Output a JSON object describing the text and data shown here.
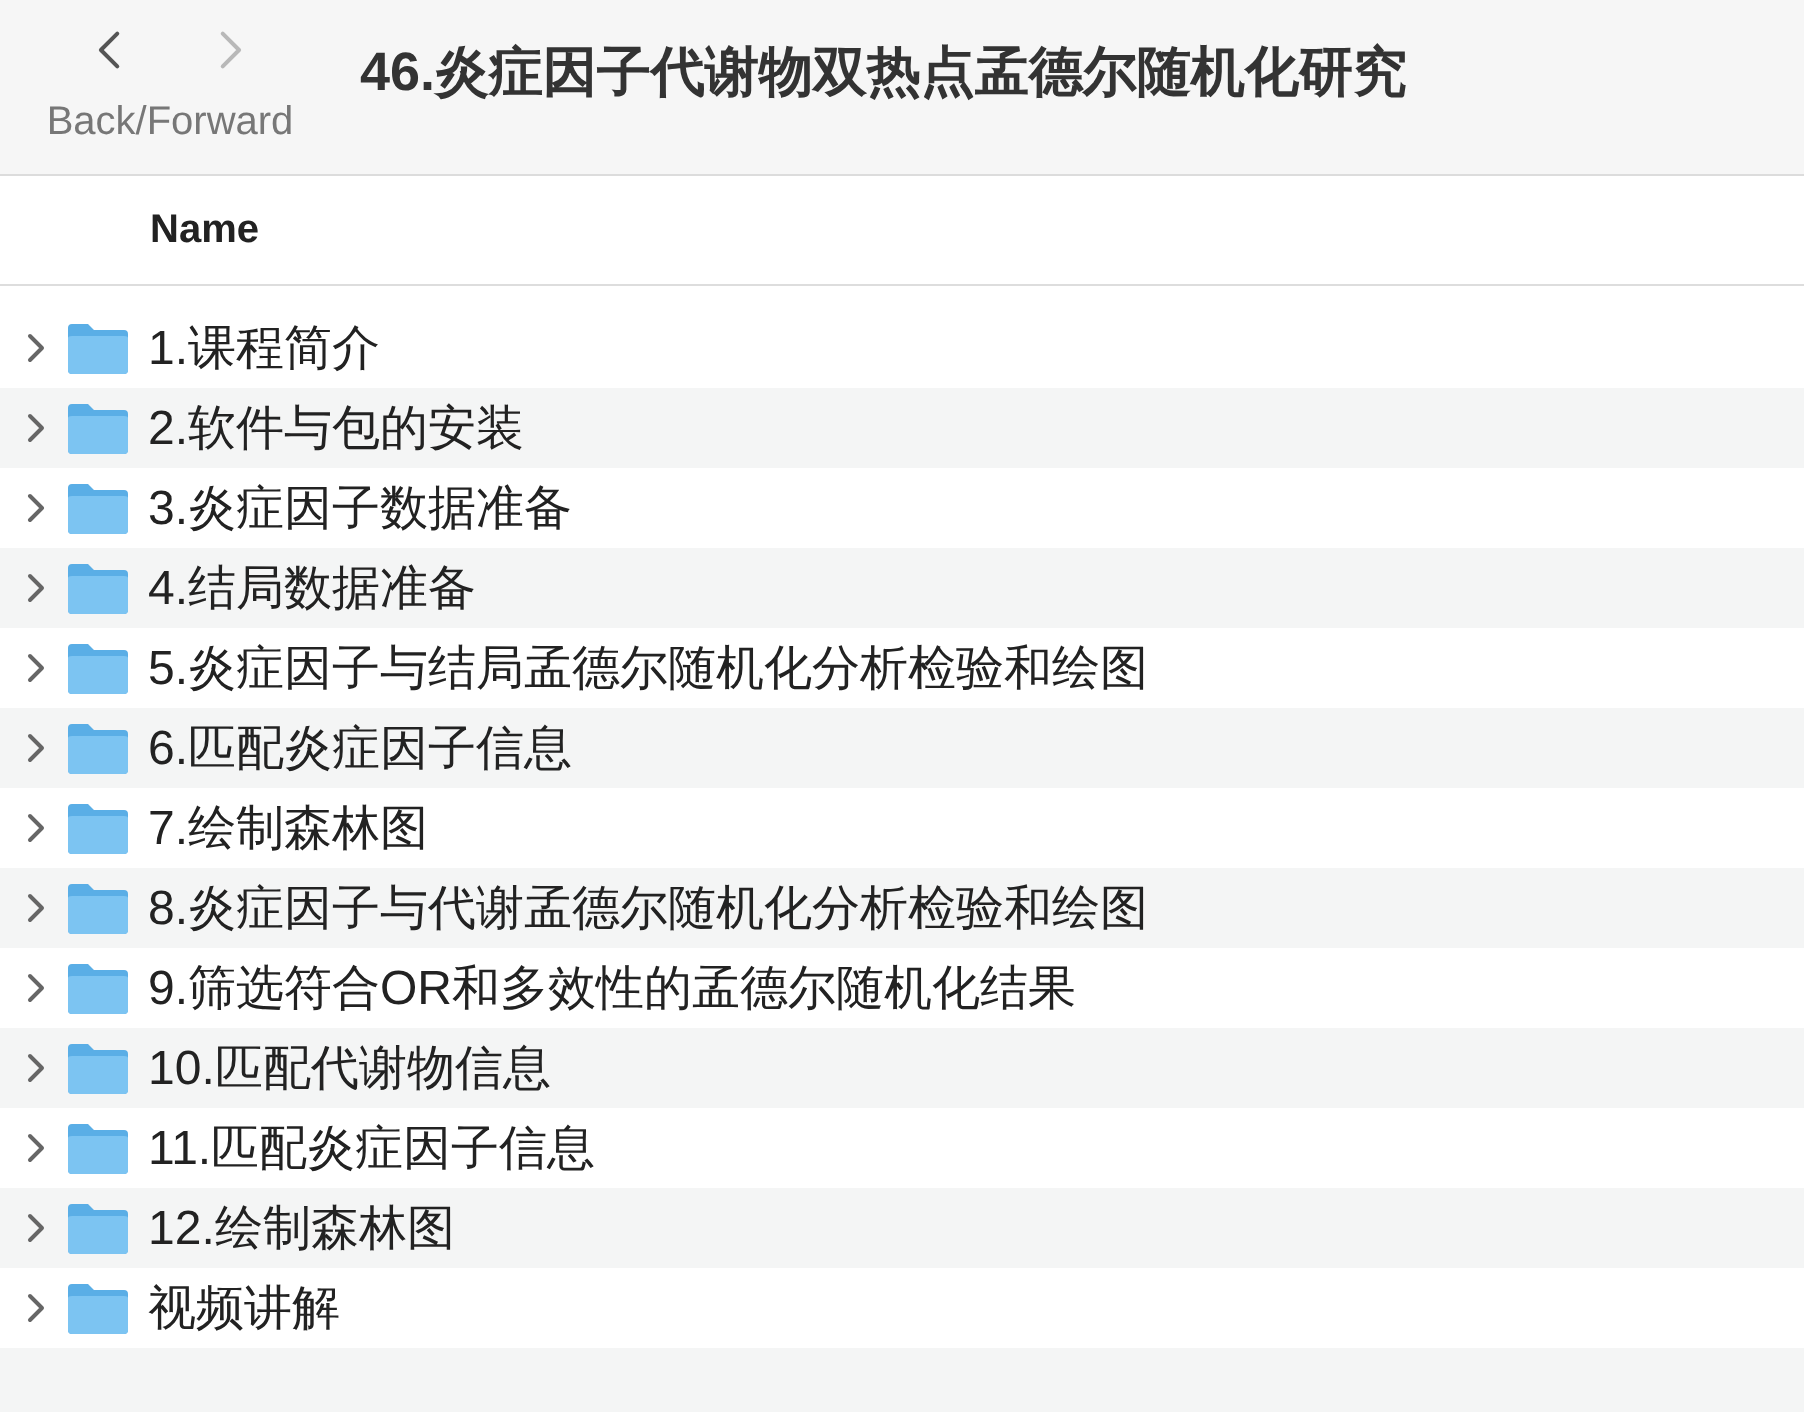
{
  "toolbar": {
    "nav_buttons": [
      {
        "kind": "back",
        "disabled": false
      },
      {
        "kind": "forward",
        "disabled": true
      }
    ],
    "nav_label": "Back/Forward",
    "title": "46.炎症因子代谢物双热点孟德尔随机化研究"
  },
  "table": {
    "columns": [
      "Name"
    ],
    "rows": [
      {
        "name": "1.课程简介",
        "expanded": false
      },
      {
        "name": "2.软件与包的安装",
        "expanded": false
      },
      {
        "name": "3.炎症因子数据准备",
        "expanded": false
      },
      {
        "name": "4.结局数据准备",
        "expanded": false
      },
      {
        "name": "5.炎症因子与结局孟德尔随机化分析检验和绘图",
        "expanded": false
      },
      {
        "name": "6.匹配炎症因子信息",
        "expanded": false
      },
      {
        "name": "7.绘制森林图",
        "expanded": false
      },
      {
        "name": "8.炎症因子与代谢孟德尔随机化分析检验和绘图",
        "expanded": false
      },
      {
        "name": "9.筛选符合OR和多效性的孟德尔随机化结果",
        "expanded": false
      },
      {
        "name": "10.匹配代谢物信息",
        "expanded": false
      },
      {
        "name": "11.匹配炎症因子信息",
        "expanded": false
      },
      {
        "name": "12.绘制森林图",
        "expanded": false
      },
      {
        "name": "视频讲解",
        "expanded": false
      }
    ]
  }
}
